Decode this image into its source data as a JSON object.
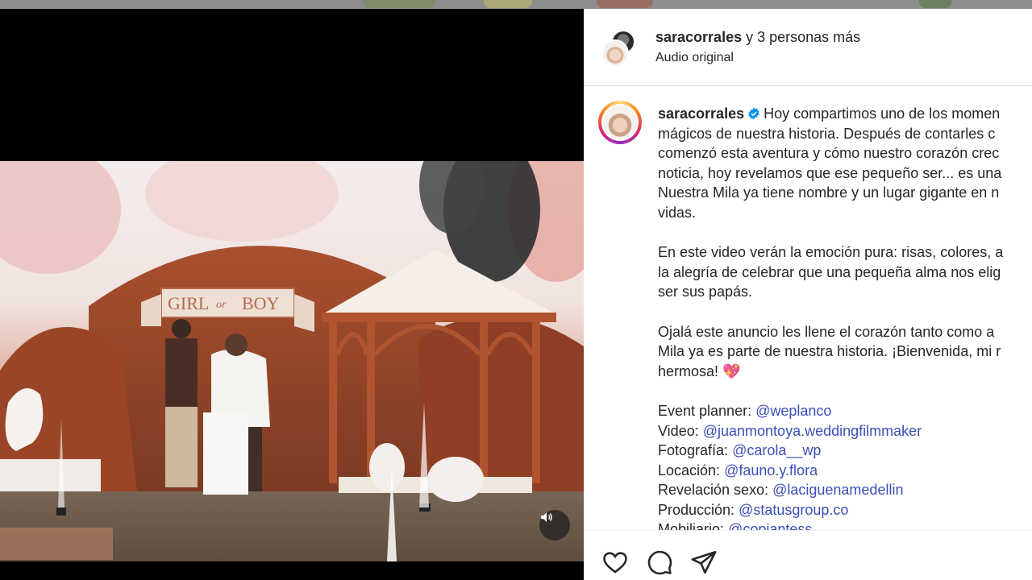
{
  "header": {
    "username": "saracorrales",
    "others_text": "y 3 personas más",
    "audio": "Audio original"
  },
  "caption": {
    "username": "saracorrales",
    "first_line_text": "Hoy compartimos uno de los momen",
    "lines": [
      "mágicos de nuestra historia. Después de contarles c",
      "comenzó esta aventura y cómo nuestro corazón crec",
      "noticia, hoy revelamos que ese pequeño ser... es una",
      "Nuestra Mila ya tiene nombre y un lugar gigante en n",
      "vidas.",
      "",
      "En este video verán la emoción pura: risas, colores, a",
      "la alegría de celebrar que una pequeña alma nos elig",
      "ser sus papás.",
      "",
      "Ojalá este anuncio les llene el corazón tanto como a",
      "Mila ya es parte de nuestra historia. ¡Bienvenida, mi r"
    ],
    "last_line": "hermosa!",
    "heart_emoji": "💖",
    "credits": [
      {
        "label": "Event planner:",
        "mention": "@weplanco"
      },
      {
        "label": "Video:",
        "mention": "@juanmontoya.weddingfilmmaker"
      },
      {
        "label": "Fotografía:",
        "mention": "@carola__wp"
      },
      {
        "label": "Locación:",
        "mention": "@fauno.y.flora"
      },
      {
        "label": "Revelación sexo:",
        "mention": "@laciguenamedellin"
      },
      {
        "label": "Producción:",
        "mention": "@statusgroup.co"
      },
      {
        "label": "Mobiliario:",
        "mention": "@copiantess"
      }
    ]
  },
  "video": {
    "sign_text_left": "GIRL",
    "sign_text_mid": "or",
    "sign_text_right": "BOY"
  },
  "icons": {
    "like": "heart-icon",
    "comment": "comment-icon",
    "share": "send-icon",
    "volume": "volume-icon",
    "verified": "verified-badge-icon"
  },
  "colors": {
    "mention": "#3b4fb8",
    "verified": "#0095f6",
    "text": "#262626"
  }
}
